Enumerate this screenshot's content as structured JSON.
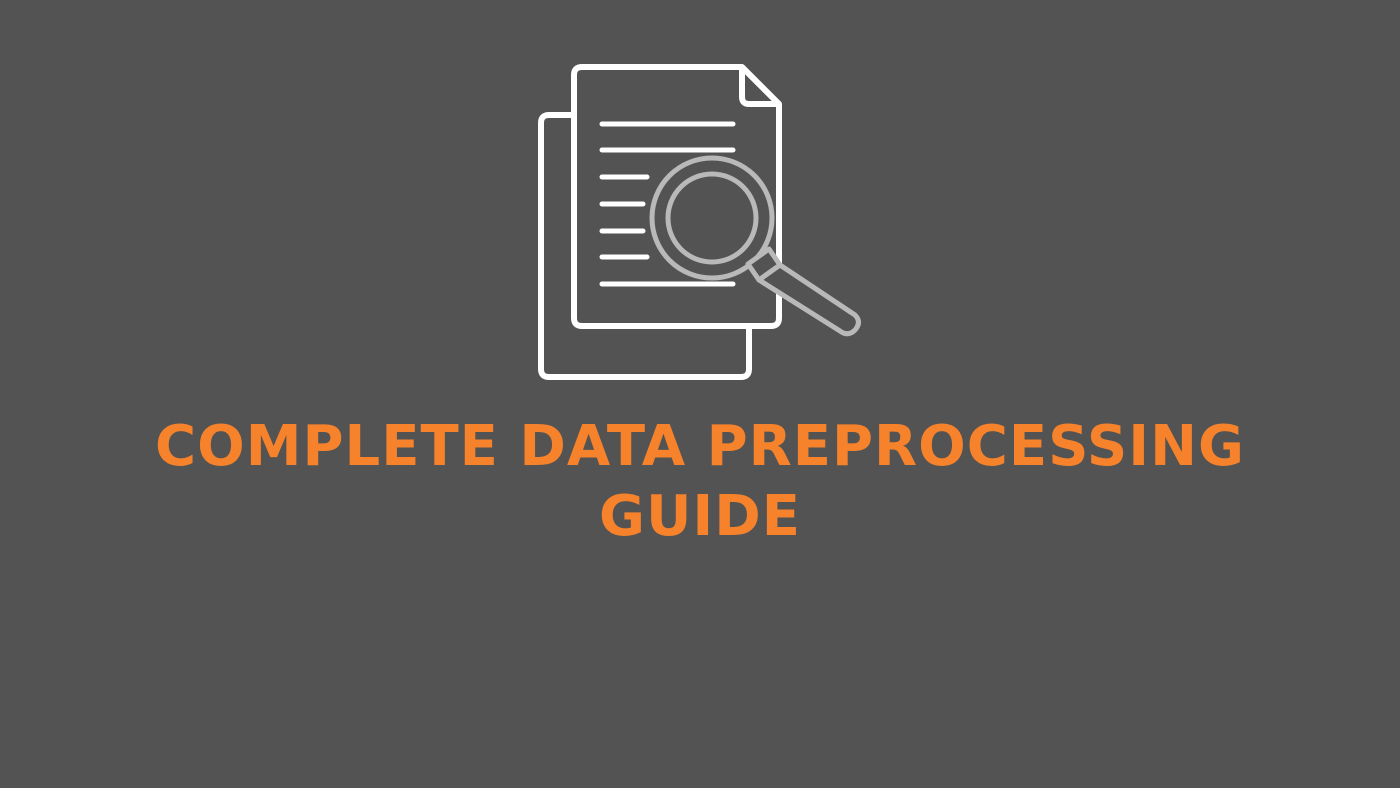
{
  "hero": {
    "icon": "document-search-icon",
    "title_line1": "COMPLETE DATA PREPROCESSING",
    "title_line2": "GUIDE"
  },
  "colors": {
    "background": "#535353",
    "accent": "#f6822b",
    "icon_stroke": "#ffffff",
    "magnifier_stroke": "#b9b9b9"
  }
}
